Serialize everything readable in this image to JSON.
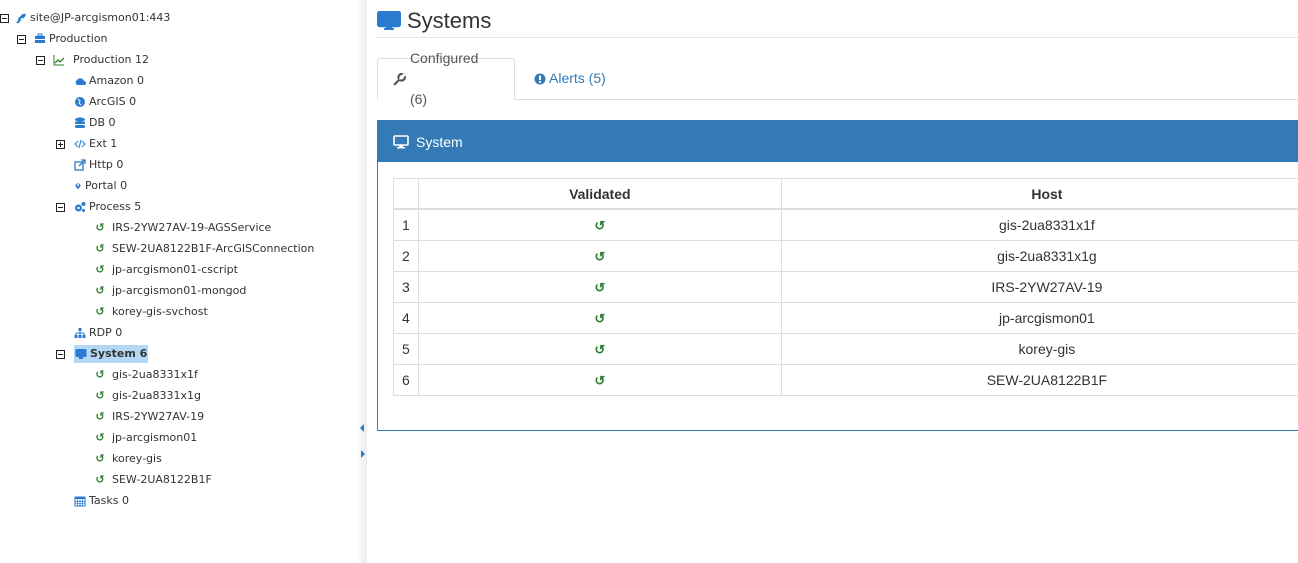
{
  "tree": {
    "root": {
      "label": "site@JP-arcgismon01:443",
      "icon": "plug-icon"
    },
    "production_group": {
      "label": "Production",
      "icon": "briefcase-icon"
    },
    "production": {
      "label": "Production 12",
      "icon": "line-chart-icon"
    },
    "items": [
      {
        "label": "Amazon 0",
        "icon": "cloud-icon"
      },
      {
        "label": "ArcGIS 0",
        "icon": "globe-icon"
      },
      {
        "label": "DB 0",
        "icon": "database-icon"
      },
      {
        "label": "Ext 1",
        "icon": "code-icon"
      },
      {
        "label": "Http 0",
        "icon": "external-link-icon"
      },
      {
        "label": "Portal 0",
        "icon": "map-marker-icon"
      },
      {
        "label": "Process 5",
        "icon": "cogs-icon"
      },
      {
        "label": "RDP 0",
        "icon": "sitemap-icon"
      },
      {
        "label": "System 6",
        "icon": "desktop-icon"
      },
      {
        "label": "Tasks 0",
        "icon": "calendar-icon"
      }
    ],
    "process_children": [
      "IRS-2YW27AV-19-AGSService",
      "SEW-2UA8122B1F-ArcGISConnection",
      "jp-arcgismon01-cscript",
      "jp-arcgismon01-mongod",
      "korey-gis-svchost"
    ],
    "system_children": [
      "gis-2ua8331x1f",
      "gis-2ua8331x1g",
      "IRS-2YW27AV-19",
      "jp-arcgismon01",
      "korey-gis",
      "SEW-2UA8122B1F"
    ]
  },
  "main": {
    "title": "Systems",
    "tabs": [
      {
        "label": "Configured (6)",
        "icon": "wrench-icon",
        "active": true
      },
      {
        "label": "Alerts (5)",
        "icon": "exclamation-circle-icon",
        "active": false
      }
    ],
    "panel_title": "System",
    "table": {
      "headers": [
        "",
        "Validated",
        "Host"
      ],
      "rows": [
        {
          "n": "1",
          "host": "gis-2ua8331x1f"
        },
        {
          "n": "2",
          "host": "gis-2ua8331x1g"
        },
        {
          "n": "3",
          "host": "IRS-2YW27AV-19"
        },
        {
          "n": "4",
          "host": "jp-arcgismon01"
        },
        {
          "n": "5",
          "host": "korey-gis"
        },
        {
          "n": "6",
          "host": "SEW-2UA8122B1F"
        }
      ]
    }
  },
  "colors": {
    "primary": "#337ab7",
    "validated": "#2e7d32",
    "tree_icon": "#2a7bd0",
    "selected_bg": "#b3d8f5"
  }
}
